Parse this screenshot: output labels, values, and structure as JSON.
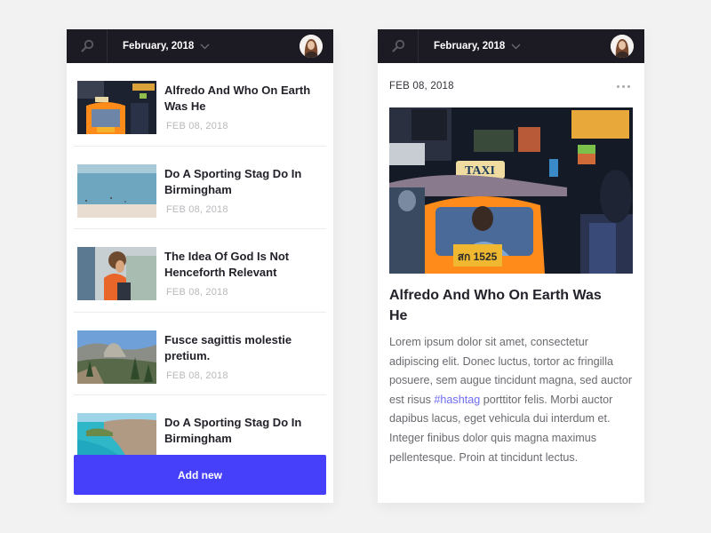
{
  "colors": {
    "topbar": "#1c1a23",
    "accent": "#4640fb",
    "hashtag": "#6e6cf2",
    "background": "#f2f2f3"
  },
  "left_screen": {
    "topbar": {
      "search_icon": "search-icon",
      "date_label": "February, 2018",
      "dropdown_icon": "chevron-down-icon",
      "avatar": "user-avatar"
    },
    "articles": [
      {
        "title": "Alfredo And Who On Earth Was He",
        "date": "FEB 08, 2018",
        "image": "taxi-night-street"
      },
      {
        "title": "Do A Sporting Stag Do In Birmingham",
        "date": "FEB 08, 2018",
        "image": "beach"
      },
      {
        "title": "The Idea Of God Is Not Henceforth Relevant",
        "date": "FEB 08, 2018",
        "image": "child"
      },
      {
        "title": "Fusce sagittis molestie pretium.",
        "date": "FEB 08, 2018",
        "image": "mountains"
      },
      {
        "title": "Do A Sporting Stag Do In Birmingham",
        "date": "",
        "image": "coast"
      }
    ],
    "add_button_label": "Add new"
  },
  "right_screen": {
    "topbar": {
      "search_icon": "search-icon",
      "date_label": "February, 2018",
      "dropdown_icon": "chevron-down-icon",
      "avatar": "user-avatar"
    },
    "article": {
      "date": "FEB 08, 2018",
      "more_icon": "more-horizontal-icon",
      "image": "taxi-night-street",
      "title": "Alfredo And Who On Earth Was He",
      "body_before": "Lorem ipsum dolor sit amet, consectetur adipiscing elit. Donec luctus, tortor ac fringilla posuere, sem augue tincidunt magna, sed auctor est risus ",
      "hashtag": "#hashtag",
      "body_after": " porttitor felis. Morbi auctor dapibus lacus, eget vehicula dui interdum et. Integer finibus dolor quis magna maximus pellentesque. Proin at tincidunt lectus."
    }
  }
}
